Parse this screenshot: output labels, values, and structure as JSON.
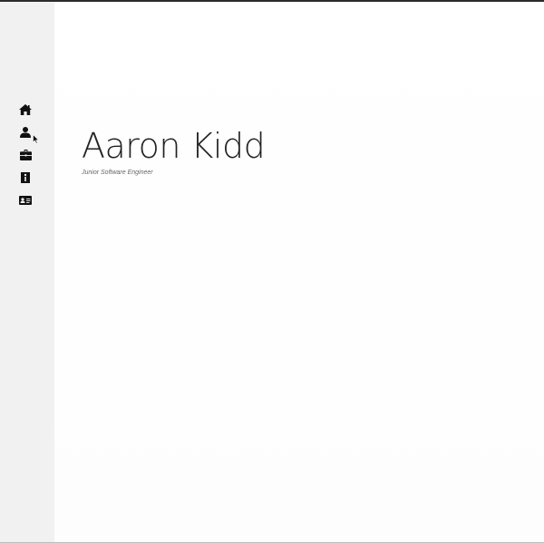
{
  "sidebar": {
    "items": [
      {
        "icon": "home-icon"
      },
      {
        "icon": "user-icon"
      },
      {
        "icon": "briefcase-icon"
      },
      {
        "icon": "info-icon"
      },
      {
        "icon": "contact-card-icon"
      }
    ]
  },
  "hero": {
    "name": "Aaron Kidd",
    "title": "Junior Software Engineer"
  },
  "colors": {
    "sidebar_bg": "#f1f1f1",
    "icon": "#111111",
    "text": "#222222"
  }
}
